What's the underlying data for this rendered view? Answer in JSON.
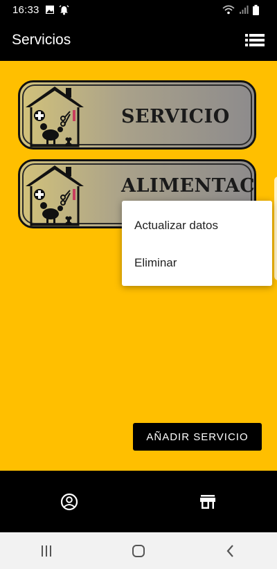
{
  "status_bar": {
    "time": "16:33",
    "left_icons": [
      "image-icon",
      "alarm-bell-icon"
    ],
    "right_icons": [
      "wifi-icon",
      "signal-icon",
      "battery-icon"
    ]
  },
  "app_bar": {
    "title": "Servicios",
    "menu_icon": "list-menu-icon"
  },
  "cards": [
    {
      "title": "SERVICIO",
      "icon": "pet-house-icon"
    },
    {
      "title": "ALIMENTACIÓN",
      "icon": "pet-house-icon"
    }
  ],
  "popup_menu": {
    "items": [
      "Actualizar datos",
      "Eliminar"
    ]
  },
  "add_button": {
    "label": "AÑADIR SERVICIO"
  },
  "bottom_nav": {
    "items": [
      "account-circle-icon",
      "store-icon"
    ]
  },
  "system_nav": {
    "items": [
      "recent-apps-icon",
      "home-icon",
      "back-icon"
    ]
  },
  "colors": {
    "background": "#FFBF00",
    "bars": "#000000",
    "card_gradient_start": "#d2c27a",
    "card_gradient_end": "#8d8b8c"
  }
}
